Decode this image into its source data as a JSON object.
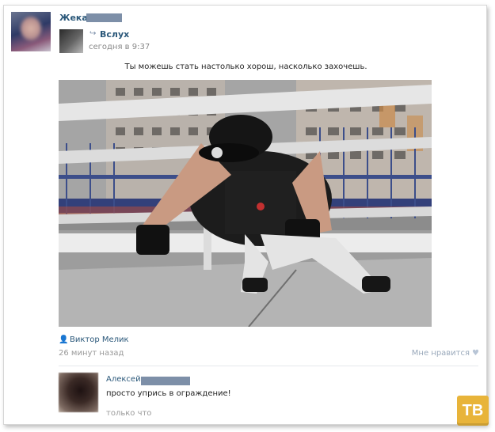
{
  "post": {
    "author_name": "Жека",
    "repost_icon": "repost-arrow-icon",
    "repost_label": "Вслух",
    "repost_time": "сегодня в 9:37",
    "text": "Ты можешь стать настолько хорош, насколько захочешь.",
    "photo_author": "Виктор Мелик",
    "post_age": "26 минут назад",
    "like_label": "Мне нравится",
    "like_icon": "heart-icon"
  },
  "comment": {
    "author": "Алексей",
    "text": "просто упрись в ограждение!",
    "time": "только что"
  },
  "watermark": "ТВ",
  "colors": {
    "link": "#2b587a",
    "muted": "#999999",
    "watermark_bg": "#e8b43a"
  }
}
